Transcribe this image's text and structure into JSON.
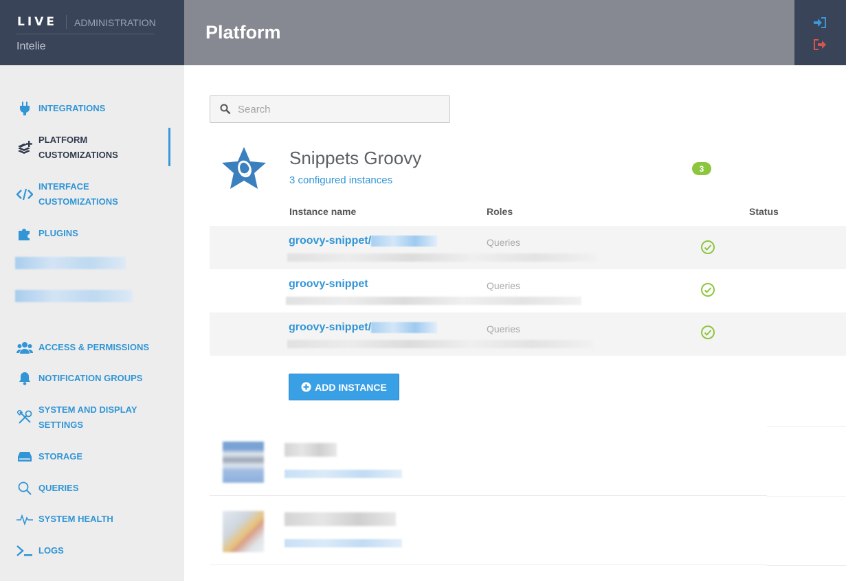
{
  "brand": {
    "logo": "LIVE",
    "section": "ADMINISTRATION",
    "org": "Intelie"
  },
  "header": {
    "title": "Platform"
  },
  "sidebar": {
    "items": [
      {
        "label": "INTEGRATIONS",
        "icon": "plug-icon"
      },
      {
        "label": "PLATFORM CUSTOMIZATIONS",
        "icon": "layers-plus-icon",
        "active": true
      },
      {
        "label": "INTERFACE CUSTOMIZATIONS",
        "icon": "code-icon"
      },
      {
        "label": "PLUGINS",
        "icon": "puzzle-icon"
      },
      {
        "label": "ACCESS & PERMISSIONS",
        "icon": "users-icon"
      },
      {
        "label": "NOTIFICATION GROUPS",
        "icon": "bell-icon"
      },
      {
        "label": "SYSTEM AND DISPLAY SETTINGS",
        "icon": "tools-icon"
      },
      {
        "label": "STORAGE",
        "icon": "hdd-icon"
      },
      {
        "label": "QUERIES",
        "icon": "search-icon"
      },
      {
        "label": "SYSTEM HEALTH",
        "icon": "heartbeat-icon"
      },
      {
        "label": "LOGS",
        "icon": "terminal-icon"
      }
    ]
  },
  "search": {
    "placeholder": "Search"
  },
  "integration": {
    "title": "Snippets Groovy",
    "subtitle": "3 configured instances",
    "badge": "3",
    "columns": {
      "name": "Instance name",
      "roles": "Roles",
      "status": "Status"
    },
    "instances": [
      {
        "name": "groovy-snippet/",
        "role": "Queries",
        "status": "ok"
      },
      {
        "name": "groovy-snippet",
        "role": "Queries",
        "status": "ok"
      },
      {
        "name": "groovy-snippet/",
        "role": "Queries",
        "status": "ok"
      }
    ],
    "add_label": "ADD INSTANCE"
  },
  "colors": {
    "accent": "#3195d6",
    "badge": "#8cc63f",
    "sidebar_dark": "#3a4458",
    "header": "#868892",
    "status_ok": "#8cc63f"
  }
}
